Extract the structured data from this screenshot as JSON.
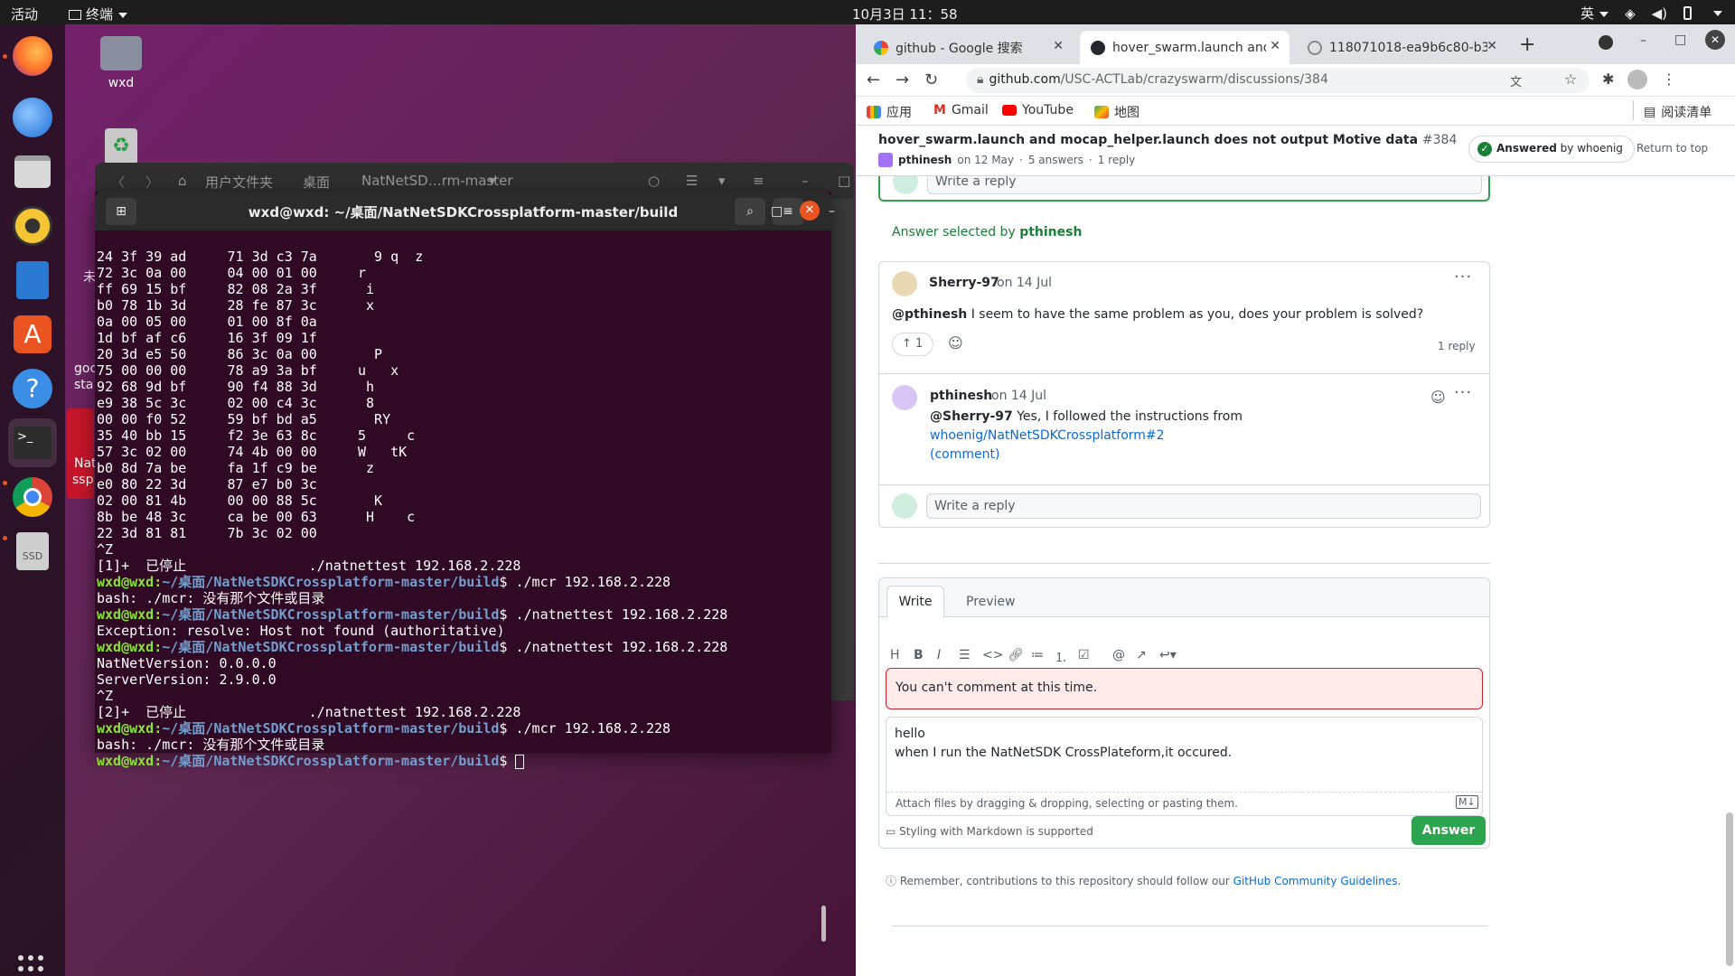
{
  "topbar": {
    "activities": "活动",
    "app_name": "终端",
    "clock": "10月3日  11：58",
    "input_method": "英"
  },
  "desktop": {
    "home_label": "wxd",
    "partial_1": "未",
    "partial_2": "goc",
    "partial_3": "sta",
    "partial_4": "Nat",
    "partial_5": "ssp"
  },
  "filemanager": {
    "path_1": "用户文件夹",
    "path_2": "桌面",
    "path_3": "NatNetSD…rm-master"
  },
  "terminal": {
    "title": "wxd@wxd: ~/桌面/NatNetSDKCrossplatform-master/build",
    "hex_lines": [
      "24 3f 39 ad     71 3d c3 7a       9 q  z",
      "72 3c 0a 00     04 00 01 00     r",
      "ff 69 15 bf     82 08 2a 3f      i",
      "b0 78 1b 3d     28 fe 87 3c      x",
      "0a 00 05 00     01 00 8f 0a",
      "1d bf af c6     16 3f 09 1f",
      "20 3d e5 50     86 3c 0a 00       P",
      "75 00 00 00     78 a9 3a bf     u   x",
      "92 68 9d bf     90 f4 88 3d      h",
      "e9 38 5c 3c     02 00 c4 3c      8",
      "00 00 f0 52     59 bf bd a5       RY",
      "35 40 bb 15     f2 3e 63 8c     5     c",
      "57 3c 02 00     74 4b 00 00     W   tK",
      "b0 8d 7a be     fa 1f c9 be      z",
      "e0 80 22 3d     87 e7 b0 3c",
      "02 00 81 4b     00 00 88 5c       K",
      "8b be 48 3c     ca be 00 63      H    c",
      "22 3d 81 81     7b 3c 02 00"
    ],
    "ctrl_z": "^Z",
    "stopped_1": "[1]+  已停止               ./natnettest 192.168.2.228",
    "prompt_user": "wxd@wxd",
    "prompt_path": "~/桌面/NatNetSDKCrossplatform-master/build",
    "cmd_1": "$ ./mcr 192.168.2.228",
    "err_1": "bash: ./mcr: 没有那个文件或目录",
    "cmd_2": "$ ./natnettest 192.168.2.228",
    "exception": "Exception: resolve: Host not found (authoritative)",
    "cmd_3": "$ ./natnettest 192.168.2.228",
    "natnet_version": "NatNetVersion: 0.0.0.0",
    "server_version": "ServerVersion: 2.9.0.0",
    "ctrl_z_2": "^Z",
    "stopped_2": "[2]+  已停止               ./natnettest 192.168.2.228",
    "cmd_4": "$ ./mcr 192.168.2.228",
    "err_2": "bash: ./mcr: 没有那个文件或目录",
    "cmd_5": "$ "
  },
  "browser": {
    "tabs": [
      {
        "label": "github - Google 搜索"
      },
      {
        "label": "hover_swarm.launch and"
      },
      {
        "label": "118071018-ea9b6c80-b3e"
      }
    ],
    "url_host": "github.com",
    "url_path": "/USC-ACTLab/crazyswarm/discussions/384",
    "bookmarks": {
      "apps": "应用",
      "gmail": "Gmail",
      "youtube": "YouTube",
      "maps": "地图",
      "reading_list": "阅读清单"
    }
  },
  "discussion": {
    "title": "hover_swarm.launch and mocap_helper.launch does not output Motive data",
    "number": "#384",
    "author": "pthinesh",
    "date": "on 12 May",
    "answers": "5 answers",
    "replies": "1 reply",
    "answered_label": "Answered",
    "answered_by": "by whoenig",
    "return_top": "Return to top",
    "write_reply": "Write a reply",
    "answer_selected": "Answer selected by",
    "answer_selected_user": "pthinesh",
    "comment": {
      "user": "Sherry-97",
      "date": "on 14 Jul",
      "mention": "@pthinesh",
      "text": " I seem to have the same problem as you, does your problem is solved?",
      "upvotes": "1",
      "reply_count": "1 reply"
    },
    "reply": {
      "user": "pthinesh",
      "date": "on 14 Jul",
      "mention": "@Sherry-97",
      "text": " Yes, I followed the instructions from ",
      "link": "whoenig/NatNetSDKCrossplatform#2",
      "link2": "(comment)"
    },
    "editor": {
      "tab_write": "Write",
      "tab_preview": "Preview",
      "error": "You can't comment at this time.",
      "line1": "hello",
      "line2": "when I run the NatNetSDK CrossPlateform,it occured.",
      "attach": "Attach files by dragging & dropping, selecting or pasting them.",
      "markdown": "Styling with Markdown is supported",
      "answer_btn": "Answer"
    },
    "footer": {
      "text": "Remember, contributions to this repository should follow our ",
      "link": "GitHub Community Guidelines",
      "end": "."
    }
  }
}
